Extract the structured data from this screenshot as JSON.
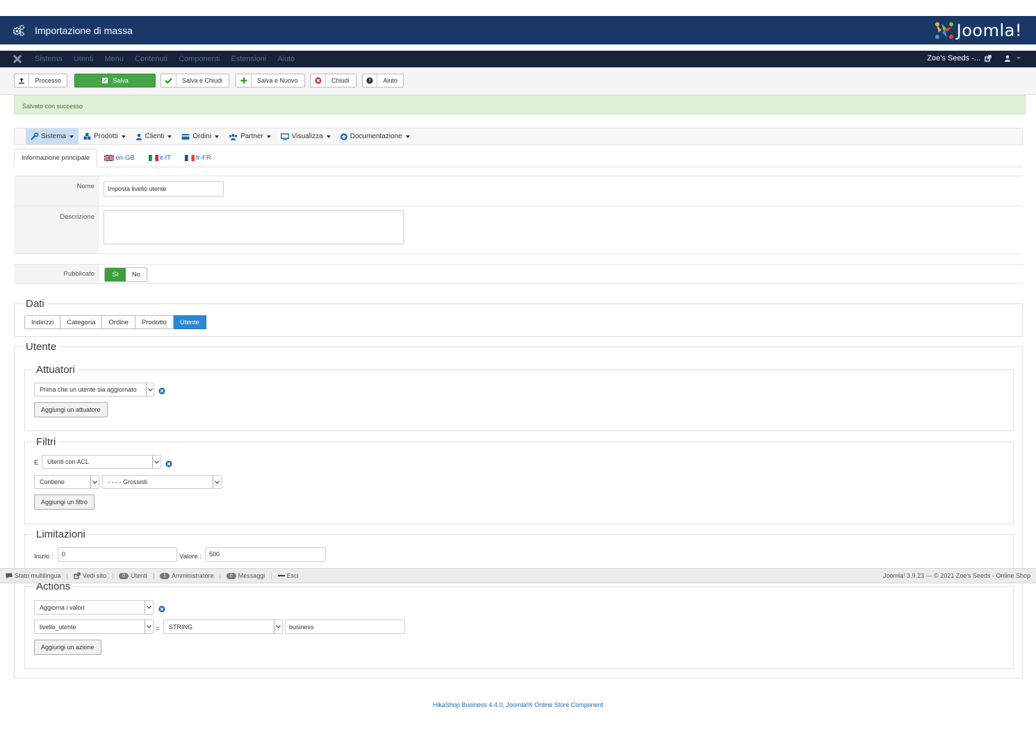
{
  "header": {
    "title": "Importazione di massa",
    "logo_text": "Joomla!"
  },
  "navbar": {
    "items": [
      "Sistema",
      "Utenti",
      "Menu",
      "Contenuti",
      "Componenti",
      "Estensioni",
      "Aiuto"
    ],
    "site_name": "Zoe's Seeds -..."
  },
  "toolbar": {
    "process": "Processo",
    "save": "Salva",
    "save_close": "Salva e Chiudi",
    "save_new": "Salva e Nuovo",
    "close": "Chiudi",
    "help": "Aiuto"
  },
  "message": {
    "text": "Salvato con successo"
  },
  "hikamenu": {
    "items": [
      "Sistema",
      "Prodotti",
      "Clienti",
      "Ordini",
      "Partner",
      "Visualizza",
      "Documentazione"
    ]
  },
  "lang_tabs": [
    "Informazione principale",
    "en-GB",
    "it-IT",
    "fr-FR"
  ],
  "form": {
    "name_label": "Nome",
    "name_value": "Imposta livello utente",
    "desc_label": "Descrizione",
    "desc_value": "",
    "published_label": "Pubblicato",
    "yes": "Sì",
    "no": "No"
  },
  "dati": {
    "legend": "Dati",
    "tabs": [
      "Indirizzi",
      "Categoria",
      "Ordine",
      "Prodotto",
      "Utente"
    ],
    "active": "Utente"
  },
  "utente": {
    "legend": "Utente",
    "attuatori": {
      "legend": "Attuatori",
      "select": "Prima che un utente sia aggiornato",
      "add_button": "Aggiungi un attuatore"
    },
    "filtri": {
      "legend": "Filtri",
      "prefix": "E",
      "select": "Utenti con ACL",
      "op": "Contiene",
      "group": "- - - - Grossisti",
      "add_button": "Aggiungi un filtro"
    },
    "limitazioni": {
      "legend": "Limitazioni",
      "start_label": "Inizio :",
      "start_value": "0",
      "value_label": "Valore :",
      "value_value": "500"
    },
    "actions": {
      "legend": "Actions",
      "select": "Aggiorna i valori",
      "field": "livello_utente",
      "equals": "=",
      "type": "STRING",
      "value": "business",
      "add_button": "Aggiungi un azione"
    }
  },
  "statusbar": {
    "multilang": "Stato multilingua",
    "view_site": "Vedi sito",
    "users_count": "0",
    "users_label": "Utenti",
    "admins_count": "1",
    "admins_label": "Amministratore",
    "msgs_count": "0",
    "msgs_label": "Messaggi",
    "logout": "Esci",
    "right": "Joomla! 3.9.23 — © 2021 Zoe's Seeds - Online Shop"
  },
  "footer": "HikaShop Business 4.4.0, Joomla!® Online Store Component",
  "colors": {
    "header_bg": "#1a3867",
    "nav_bg": "#17233a",
    "save_green": "#46a546",
    "active_blue": "#2c87d3",
    "msg_bg": "#dff0d8"
  }
}
